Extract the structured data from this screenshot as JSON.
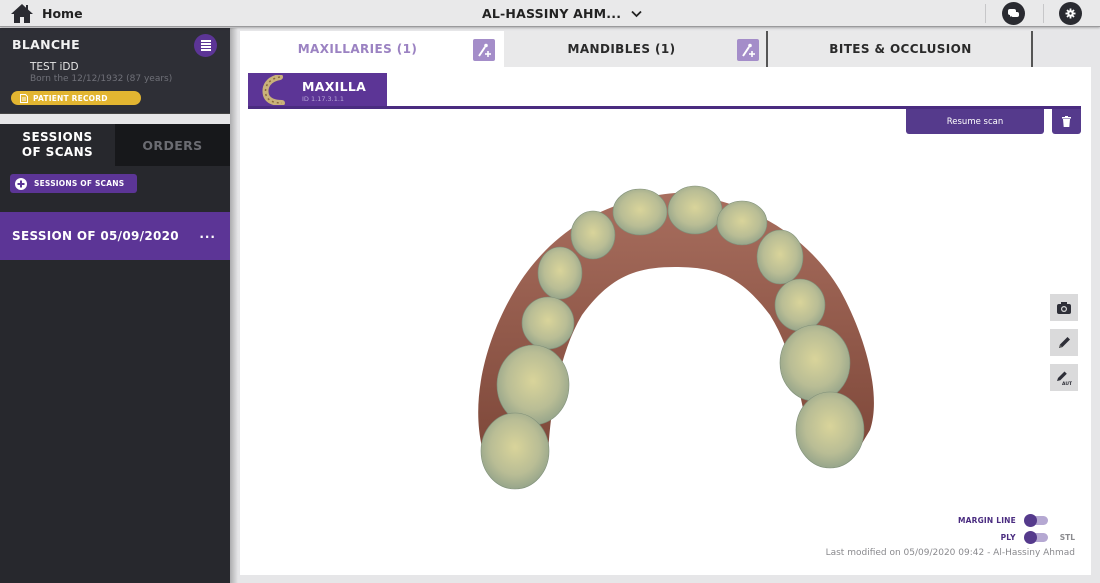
{
  "topbar": {
    "home_label": "Home",
    "patient_selector": "AL-HASSINY AHM...",
    "icons": [
      "home-icon",
      "chevron-down-icon",
      "chat-icon",
      "gear-icon"
    ]
  },
  "sidebar": {
    "patient": {
      "name": "BLANCHE",
      "test_label": "TEST iDD",
      "born": "Born the 12/12/1932 (87 years)",
      "record_button": "PATIENT RECORD"
    },
    "tabs": [
      {
        "label": "SESSIONS OF SCANS",
        "active": true
      },
      {
        "label": "ORDERS",
        "active": false
      }
    ],
    "add_session_button": "SESSIONS OF SCANS",
    "sessions": [
      {
        "label": "SESSION OF 05/09/2020",
        "more": "...",
        "selected": true
      }
    ]
  },
  "main": {
    "tabs": [
      {
        "label": "MAXILLARIES (1)",
        "active": true,
        "has_add": true
      },
      {
        "label": "MANDIBLES (1)",
        "active": false,
        "has_add": true
      },
      {
        "label": "BITES & OCCLUSION",
        "active": false,
        "has_add": false
      }
    ],
    "scan": {
      "title": "MAXILLA",
      "id": "ID 1.17.3.1.1"
    },
    "resume_button": "Resume scan",
    "tools": [
      "camera-icon",
      "pencil-icon",
      "pencil-auto-icon"
    ],
    "tool_auto_label": "AUTO",
    "toggles": {
      "margin_line": {
        "label": "MARGIN LINE",
        "on": true
      },
      "format": {
        "left": "PLY",
        "right": "STL",
        "selected": "PLY"
      }
    },
    "last_modified": "Last modified on 05/09/2020 09:42 - Al-Hassiny Ahmad"
  },
  "colors": {
    "brand_purple": "#5c3596",
    "dark_sidebar": "#27282d",
    "record_yellow": "#e2b531",
    "tab_active_text": "#9b82c2"
  }
}
